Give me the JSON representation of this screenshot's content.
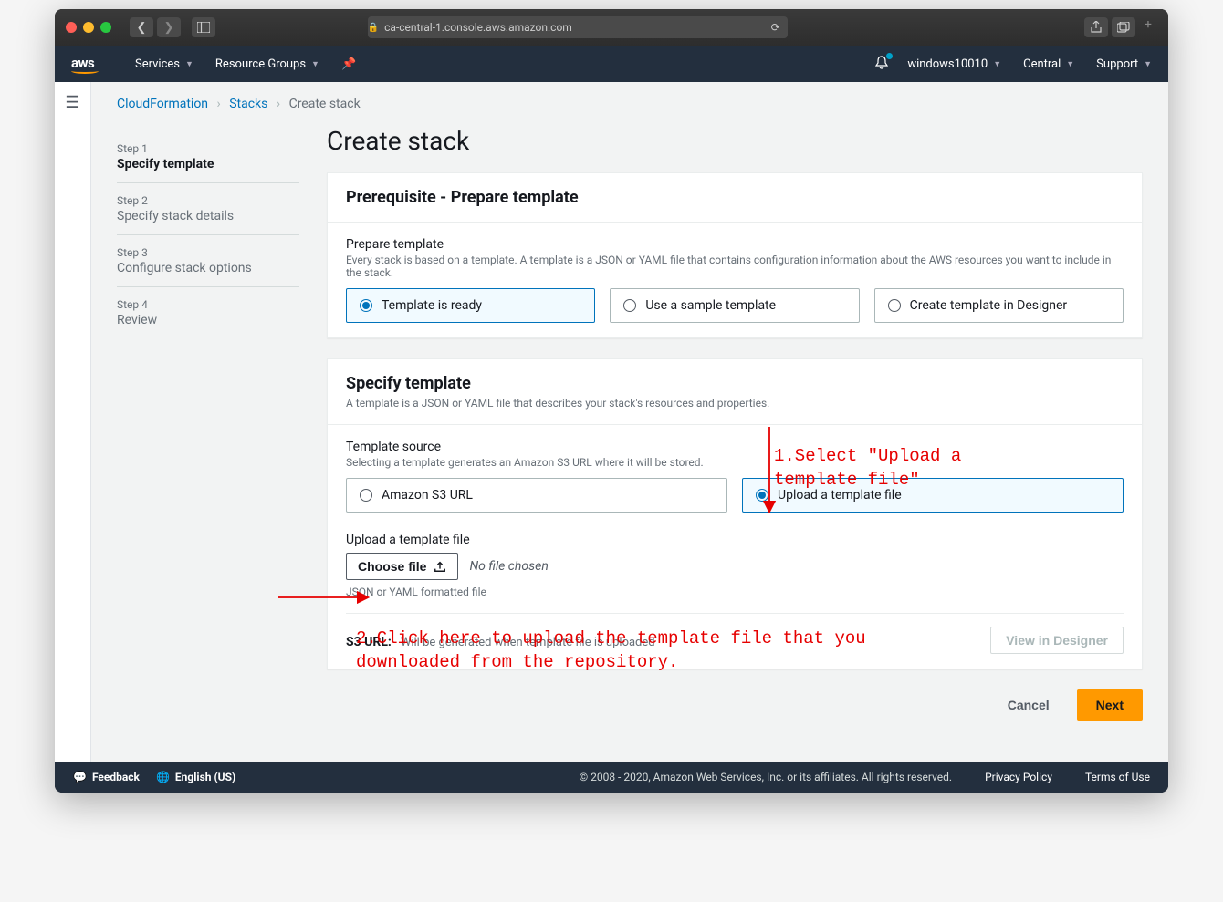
{
  "browser": {
    "url": "ca-central-1.console.aws.amazon.com"
  },
  "topnav": {
    "logo": "aws",
    "services": "Services",
    "resource_groups": "Resource Groups",
    "user": "windows10010",
    "region": "Central",
    "support": "Support"
  },
  "breadcrumb": {
    "root": "CloudFormation",
    "stacks": "Stacks",
    "current": "Create stack"
  },
  "steps": [
    {
      "num": "Step 1",
      "title": "Specify template"
    },
    {
      "num": "Step 2",
      "title": "Specify stack details"
    },
    {
      "num": "Step 3",
      "title": "Configure stack options"
    },
    {
      "num": "Step 4",
      "title": "Review"
    }
  ],
  "page": {
    "title": "Create stack"
  },
  "prereq": {
    "header": "Prerequisite - Prepare template",
    "section_label": "Prepare template",
    "section_help": "Every stack is based on a template. A template is a JSON or YAML file that contains configuration information about the AWS resources you want to include in the stack.",
    "options": {
      "ready": "Template is ready",
      "sample": "Use a sample template",
      "designer": "Create template in Designer"
    }
  },
  "specify": {
    "header": "Specify template",
    "desc": "A template is a JSON or YAML file that describes your stack's resources and properties.",
    "source_label": "Template source",
    "source_help": "Selecting a template generates an Amazon S3 URL where it will be stored.",
    "options": {
      "s3": "Amazon S3 URL",
      "upload": "Upload a template file"
    },
    "upload_label": "Upload a template file",
    "choose_file": "Choose file",
    "no_file": "No file chosen",
    "hint": "JSON or YAML formatted file",
    "s3url_label": "S3 URL:",
    "s3url_text": "Will be generated when template file is uploaded",
    "view_designer": "View in Designer"
  },
  "actions": {
    "cancel": "Cancel",
    "next": "Next"
  },
  "footer": {
    "feedback": "Feedback",
    "language": "English (US)",
    "copyright": "© 2008 - 2020, Amazon Web Services, Inc. or its affiliates. All rights reserved.",
    "privacy": "Privacy Policy",
    "terms": "Terms of Use"
  },
  "annotations": {
    "one": "1.Select \"Upload a template file\"",
    "two": "2.Click here to upload the template file that you downloaded from the repository."
  }
}
